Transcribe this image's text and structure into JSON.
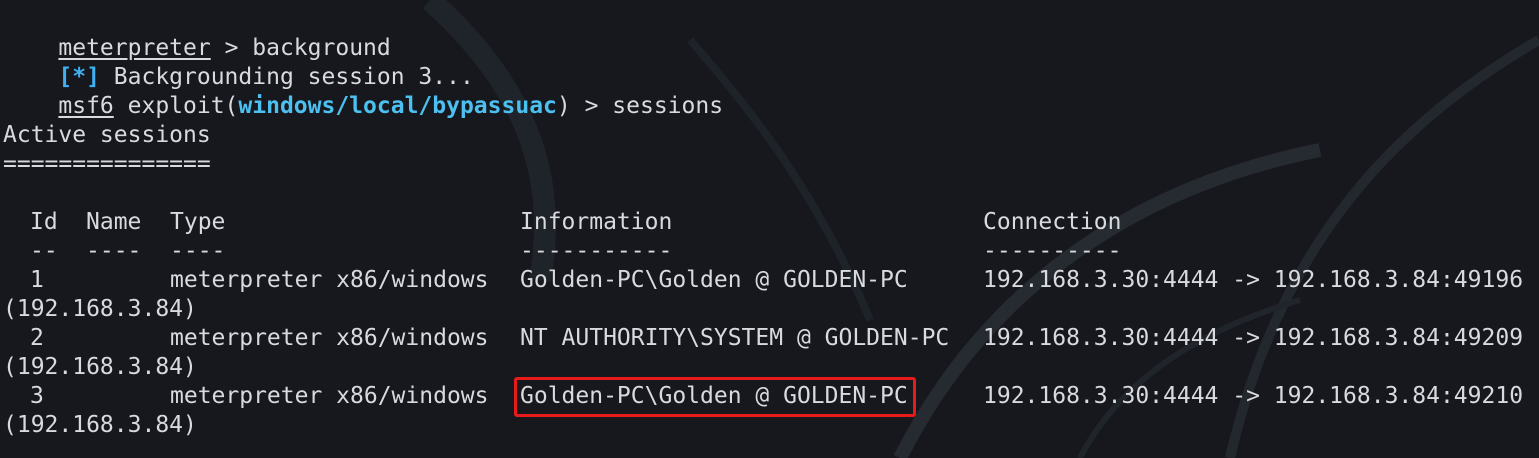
{
  "terminal": {
    "lines": {
      "cmd_background": {
        "prompt": "meterpreter",
        "sep": " > ",
        "command": "background"
      },
      "backgrounding": {
        "marker": "[*]",
        "text": " Backgrounding session 3..."
      },
      "cmd_sessions": {
        "prompt": "msf6",
        "exploit_prefix": " exploit(",
        "module": "windows/local/bypassuac",
        "suffix": ") > ",
        "command": "sessions"
      },
      "section_title": "Active sessions",
      "section_underline": "==============="
    },
    "table": {
      "headers": {
        "id": "Id",
        "name": "Name",
        "type": "Type",
        "information": "Information",
        "connection": "Connection"
      },
      "dashes": {
        "id": "--",
        "name": "----",
        "type": "----",
        "information": "-----------",
        "connection": "----------"
      },
      "rows": [
        {
          "id": "1",
          "name": "",
          "type": "meterpreter x86/windows",
          "information": "Golden-PC\\Golden @ GOLDEN-PC",
          "connection": "192.168.3.30:4444 -> 192.168.3.84:49196",
          "wrap": "(192.168.3.84)"
        },
        {
          "id": "2",
          "name": "",
          "type": "meterpreter x86/windows",
          "information": "NT AUTHORITY\\SYSTEM @ GOLDEN-PC",
          "connection": "192.168.3.30:4444 -> 192.168.3.84:49209",
          "wrap": "(192.168.3.84)"
        },
        {
          "id": "3",
          "name": "",
          "type": "meterpreter x86/windows",
          "information": "Golden-PC\\Golden @ GOLDEN-PC",
          "connection": "192.168.3.30:4444 -> 192.168.3.84:49210",
          "wrap": "(192.168.3.84)"
        }
      ]
    },
    "colors": {
      "background": "#16181d",
      "text": "#d8dade",
      "status_marker": "#3fb1f5",
      "module": "#4cc0f0",
      "highlight_border": "#e81b1b"
    }
  }
}
